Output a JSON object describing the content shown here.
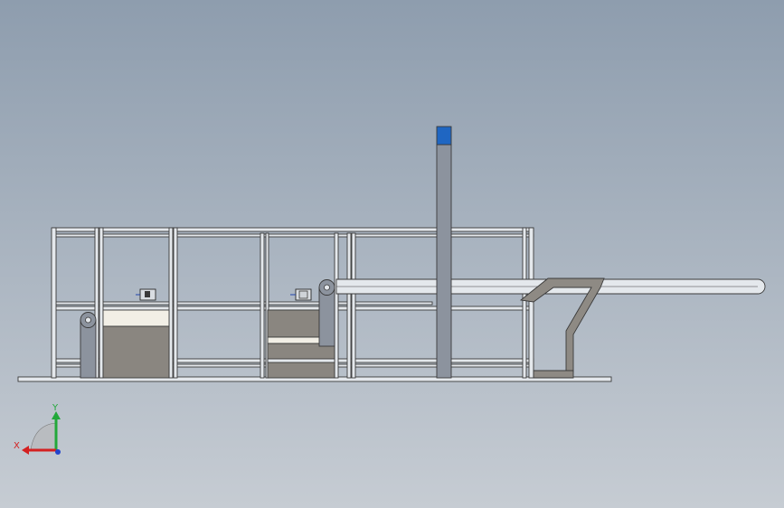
{
  "viewport": {
    "background_top": "#8e9dae",
    "background_bottom": "#c6ccd3"
  },
  "model": {
    "frame_color": "#e4e8ec",
    "frame_outline": "#3a3a3a",
    "panel_color": "#8a8680",
    "panel_light": "#f2efe6",
    "column_color": "#8c939e",
    "column_cap_color": "#1f66c2",
    "roller_color": "#8c939e",
    "hopper_color": "#8e8a84"
  },
  "triad": {
    "x_label": "X",
    "y_label": "Y",
    "x_color": "#d42020",
    "y_color": "#22a83a",
    "z_color": "#2244cc"
  }
}
